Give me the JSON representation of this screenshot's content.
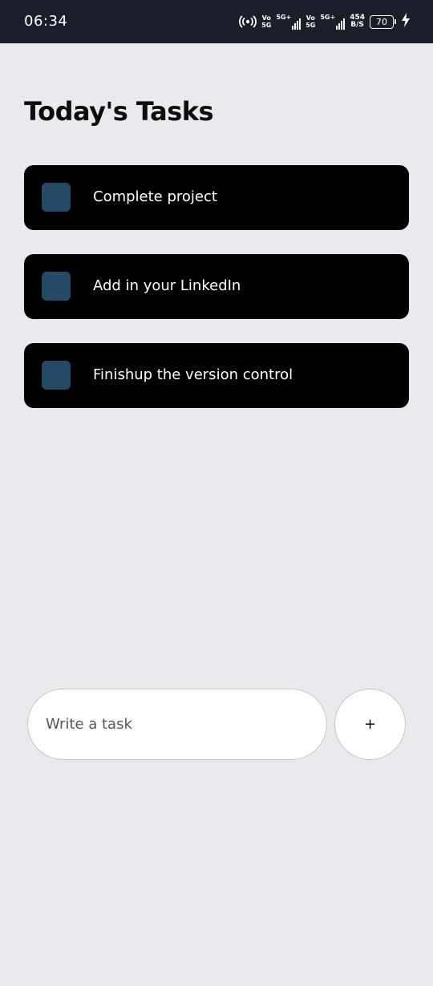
{
  "status_bar": {
    "time": "06:34",
    "sim1_tag": "Vo",
    "sim1_sub": "5G",
    "sim1_signal": "5G+",
    "sim2_tag": "Vo",
    "sim2_sub": "5G",
    "sim2_signal": "5G+",
    "speed_value": "454",
    "speed_unit": "B/S",
    "battery_level": "70",
    "icons": [
      "hotspot-icon",
      "signal-icon",
      "battery-icon",
      "charging-icon"
    ]
  },
  "page": {
    "title": "Today's Tasks"
  },
  "tasks": [
    {
      "label": "Complete project"
    },
    {
      "label": "Add in your LinkedIn"
    },
    {
      "label": "Finishup the version control"
    }
  ],
  "new_task": {
    "placeholder": "Write a task",
    "add_label": "+"
  },
  "colors": {
    "background": "#e8eaed",
    "status_bar": "#1b1f29",
    "task_card": "#000000",
    "checkbox": "#254a66"
  }
}
